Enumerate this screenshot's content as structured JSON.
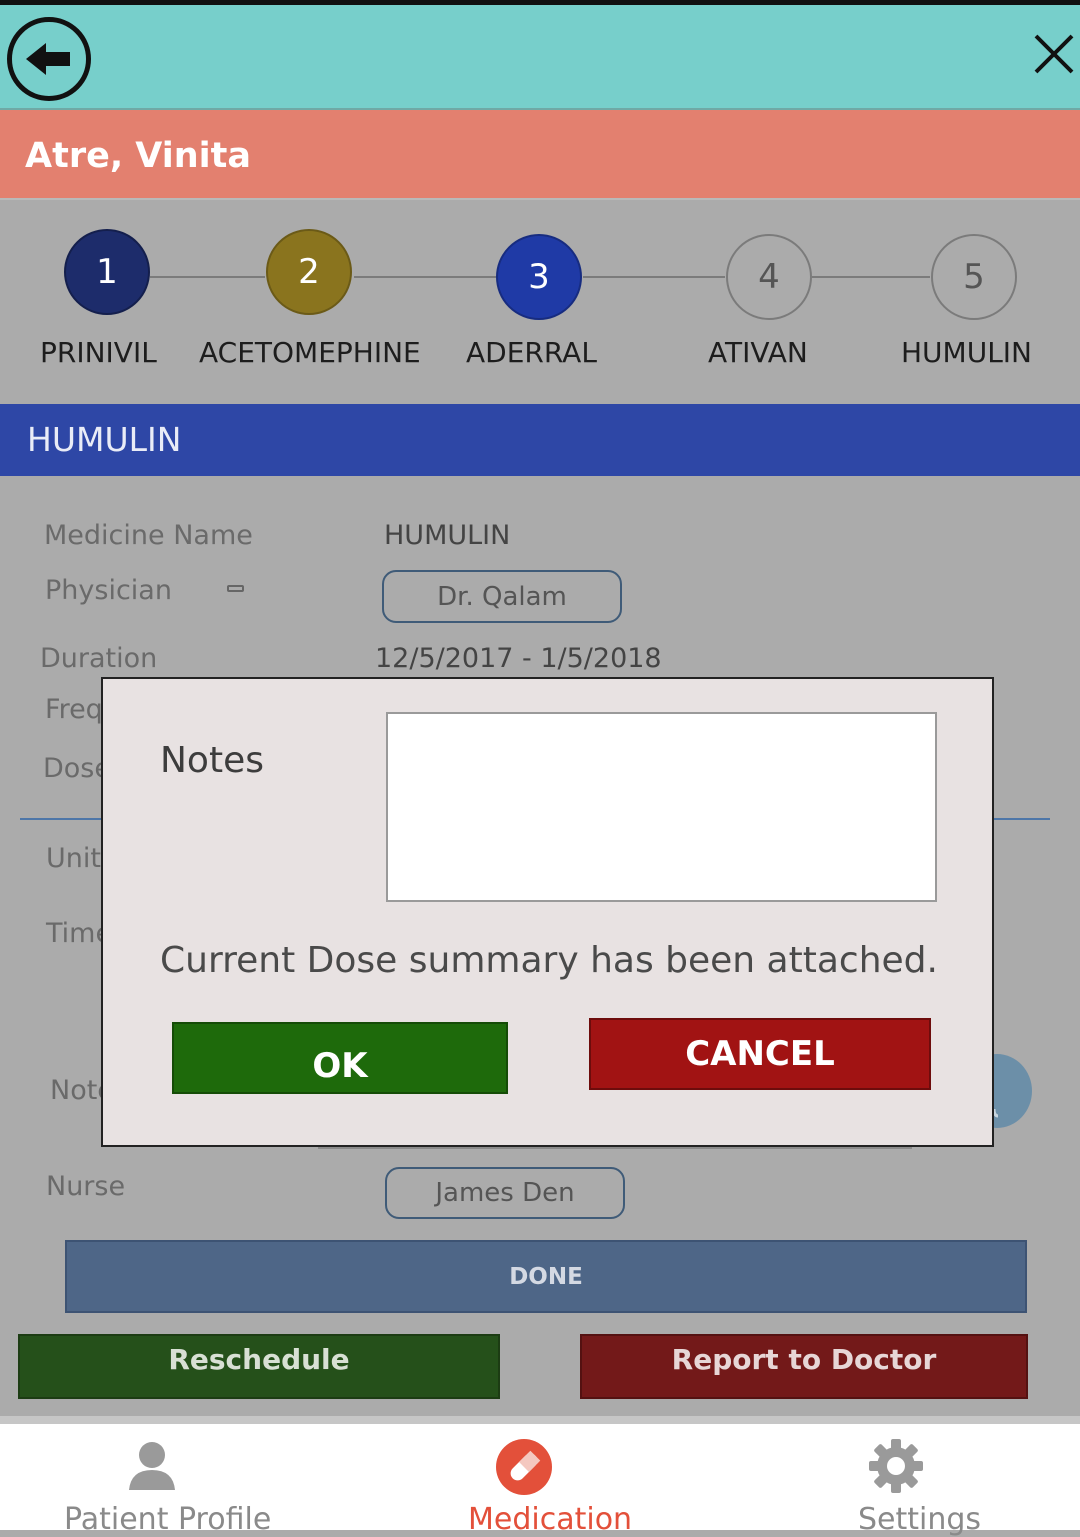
{
  "patient": {
    "name": "Atre, Vinita"
  },
  "stepper": {
    "steps": [
      {
        "number": "1",
        "label": "PRINIVIL",
        "color": "#1d2c6b"
      },
      {
        "number": "2",
        "label": "ACETOMEPHINE",
        "color": "#8a741e"
      },
      {
        "number": "3",
        "label": "ADERRAL",
        "color": "#1f3aa6"
      },
      {
        "number": "4",
        "label": "ATIVAN",
        "color": "#ababab"
      },
      {
        "number": "5",
        "label": "HUMULIN",
        "color": "#ababab"
      }
    ]
  },
  "section": {
    "title": "HUMULIN"
  },
  "form": {
    "medicine_name_label": "Medicine Name",
    "medicine_name_value": "HUMULIN",
    "physician_label": "Physician",
    "physician_value": "Dr. Qalam",
    "duration_label": "Duration",
    "duration_value": "12/5/2017 - 1/5/2018",
    "frequency_label": "Freq",
    "dose_label": "Dose",
    "unit_label": "Unit",
    "time_label": "Time",
    "notes_label": "Note",
    "nurse_label": "Nurse",
    "nurse_value": "James Den"
  },
  "dialog": {
    "notes_label": "Notes",
    "notes_value": "",
    "message": "Current Dose summary has been attached.",
    "ok_label": "OK",
    "cancel_label": "CANCEL"
  },
  "actions": {
    "done_label": "DONE",
    "reschedule_label": "Reschedule",
    "report_label": "Report to Doctor"
  },
  "nav": {
    "items": [
      {
        "label": "Patient Profile",
        "icon": "person-icon",
        "active": false
      },
      {
        "label": "Medication",
        "icon": "pill-icon",
        "active": true
      },
      {
        "label": "Settings",
        "icon": "gear-icon",
        "active": false
      }
    ]
  },
  "colors": {
    "topbar": "#77cfcb",
    "patient_bar": "#e3806f",
    "section_header": "#2e47a6",
    "ok_button": "#1e6a0b",
    "cancel_button": "#a11313",
    "active_nav": "#e3503a"
  }
}
